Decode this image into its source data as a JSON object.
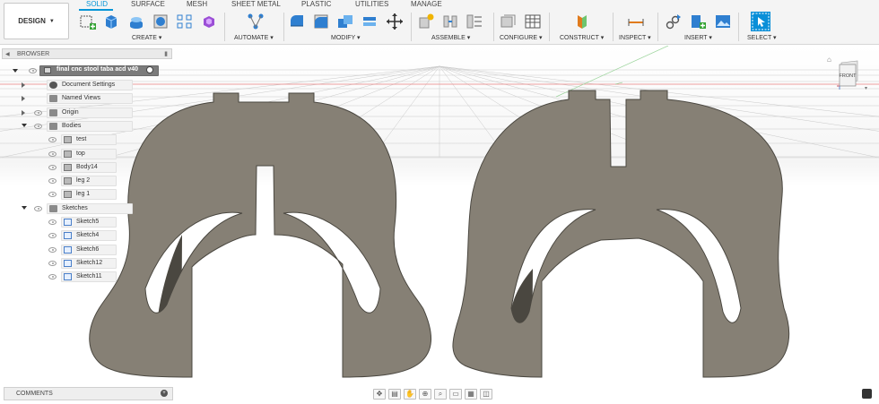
{
  "toolbar": {
    "design_label": "DESIGN",
    "tabs": [
      "SOLID",
      "SURFACE",
      "MESH",
      "SHEET METAL",
      "PLASTIC",
      "UTILITIES",
      "MANAGE"
    ],
    "groups": [
      "CREATE",
      "AUTOMATE",
      "MODIFY",
      "ASSEMBLE",
      "CONFIGURE",
      "CONSTRUCT",
      "INSPECT",
      "INSERT",
      "SELECT"
    ]
  },
  "browser": {
    "title": "BROWSER",
    "root": "final cnc stool taba acd v40",
    "items": [
      {
        "label": "Document Settings"
      },
      {
        "label": "Named Views"
      },
      {
        "label": "Origin"
      },
      {
        "label": "Bodies"
      },
      {
        "label": "test"
      },
      {
        "label": "top"
      },
      {
        "label": "Body14"
      },
      {
        "label": "leg 2"
      },
      {
        "label": "leg 1"
      },
      {
        "label": "Sketches"
      },
      {
        "label": "Sketch5"
      },
      {
        "label": "Sketch4"
      },
      {
        "label": "Sketch6"
      },
      {
        "label": "Sketch12"
      },
      {
        "label": "Sketch11"
      }
    ]
  },
  "viewcube": {
    "face": "FRONT"
  },
  "comments": {
    "label": "COMMENTS"
  },
  "colors": {
    "accent": "#0696d7",
    "part_fill": "#868075",
    "part_edge": "#4a4740"
  }
}
